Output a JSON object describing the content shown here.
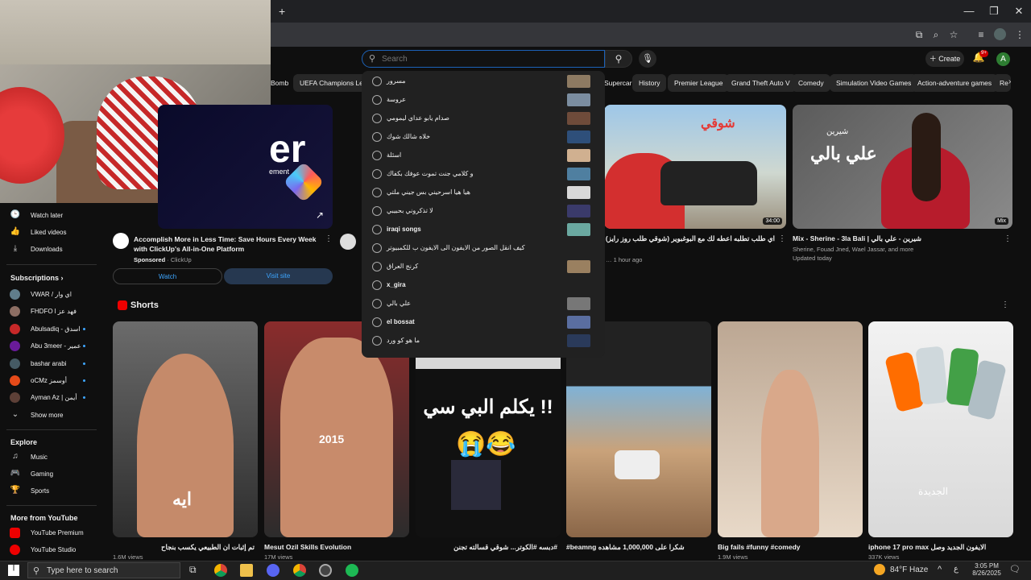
{
  "browser": {
    "new_tab": "+"
  },
  "yt": {
    "search_placeholder": "Search",
    "create_label": "Create",
    "notification_count": "9+",
    "avatar_letter": "A",
    "chips": [
      "Bomb",
      "UEFA Champions League",
      "Supercar",
      "History",
      "Premier League",
      "Grand Theft Auto V",
      "Comedy",
      "Simulation Video Games",
      "Action-adventure games",
      "Re"
    ]
  },
  "suggestions": [
    "مسرور",
    "عروسة",
    "صدام يابو عداي ليمومي",
    "خلاه شالك شوك",
    "اسئلة",
    "و كلامي جنت تموت عوفك بكفاك",
    "هيا هيا اسرحيني بس جيني ملتي",
    "لا تذكروني بحبيبي",
    "iraqi songs",
    "كيف انقل الصور من الايفون الى الايفون ب للكمبيوتر",
    "كرنج العراق",
    "x_gira",
    "علي بالي",
    "el bossat",
    "ما هو كو ورد"
  ],
  "sidebar": {
    "items": [
      {
        "icon": "🕒",
        "label": "Watch later"
      },
      {
        "icon": "👍",
        "label": "Liked videos"
      },
      {
        "icon": "⤓",
        "label": "Downloads"
      }
    ],
    "subscriptions_title": "Subscriptions",
    "subscriptions": [
      {
        "label": "VWAR / اي وار",
        "color": "#607d8b",
        "dot": false
      },
      {
        "label": "FHDFO l فهد عز",
        "color": "#8d6e63",
        "dot": false
      },
      {
        "label": "Abulsadiq - اسدق",
        "color": "#c62828",
        "dot": true
      },
      {
        "label": "Abu 3meer - عمير",
        "color": "#6a1b9a",
        "dot": true
      },
      {
        "label": "bashar arabi",
        "color": "#455a64",
        "dot": true
      },
      {
        "label": "oCMz أوسمز",
        "color": "#e64a19",
        "dot": true
      },
      {
        "label": "Ayman Az | أيمن",
        "color": "#5d4037",
        "dot": true
      }
    ],
    "show_more": "Show more",
    "explore_title": "Explore",
    "explore": [
      {
        "icon": "♫",
        "label": "Music"
      },
      {
        "icon": "🎮",
        "label": "Gaming"
      },
      {
        "icon": "🏆",
        "label": "Sports"
      }
    ],
    "more_title": "More from YouTube",
    "more": [
      {
        "label": "YouTube Premium"
      },
      {
        "label": "YouTube Studio"
      }
    ]
  },
  "ad": {
    "title": "Accomplish More in Less Time: Save Hours Every Week with ClickUp's All-in-One Platform",
    "sponsored": "Sponsored",
    "advertiser": "ClickUp",
    "watch_label": "Watch",
    "visit_label": "Visit site",
    "thumb_text": "er",
    "thumb_sub": "ement"
  },
  "videos": [
    {
      "title": "اي طلب تطلبه اعطه لك مع البوغبوير (شوقي طلب روز رايز)",
      "meta1": "… 1 hour ago",
      "duration": "34:00",
      "thumb_text": "شوقي"
    },
    {
      "title": "Mix - Sherine - 3la Bali | شيرين - علي بالي",
      "meta1": "Sherine, Fouad Jned, Wael Jassar, and more",
      "meta2": "Updated today",
      "duration": "Mix",
      "thumb_text": "علي بالي",
      "thumb_sub": "شيرين"
    }
  ],
  "shorts": {
    "title": "Shorts",
    "items": [
      {
        "title": "تم إثبات ان الطبيعي يكسب بنجاح",
        "views": "1.6M views",
        "overlay": "ايه"
      },
      {
        "title": "Mesut Ozil Skills Evolution",
        "views": "17M views",
        "overlay": "2015"
      },
      {
        "title": "#دبسه #الكوتر... شوقي قسالته تجنن",
        "views": "",
        "overlay": "يكلم البي سي !!"
      },
      {
        "title": "#beamng شكرا على 1,000,000 مشاهده",
        "views": "",
        "overlay": ""
      },
      {
        "title": "Big fails #funny #comedy",
        "views": "1.9M views",
        "overlay": ""
      },
      {
        "title": "iphone 17 pro max الايفون الجديد وصل",
        "views": "337K views",
        "overlay": "الجديدة"
      }
    ]
  },
  "taskbar": {
    "search_placeholder": "Type here to search",
    "weather": "84°F  Haze",
    "time": "3:05 PM",
    "date": "8/26/2025",
    "lang": "ع"
  }
}
